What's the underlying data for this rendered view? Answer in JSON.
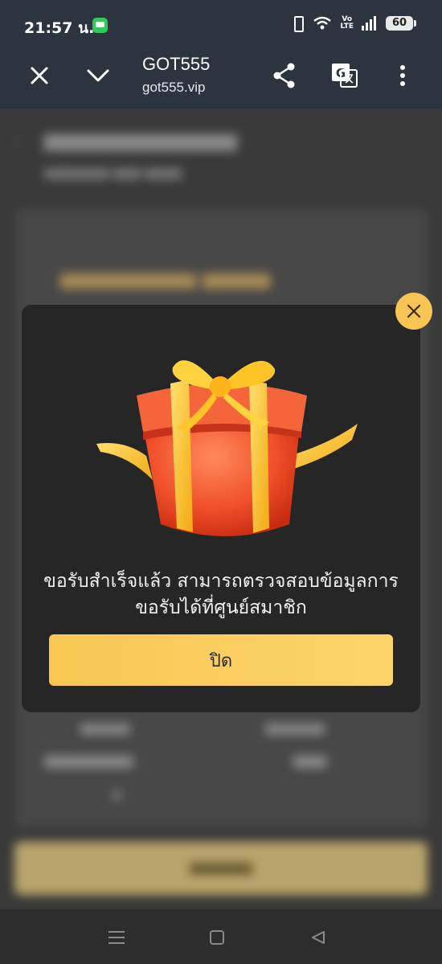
{
  "status_bar": {
    "time": "21:57 น.",
    "network_label": "Vo\nLTE",
    "battery": "60",
    "icons": [
      "message-icon",
      "vibrate-icon",
      "wifi-icon",
      "signal-icon",
      "battery-icon"
    ]
  },
  "browser": {
    "title": "GOT555",
    "url": "got555.vip",
    "icons": [
      "close-icon",
      "chevron-down-icon",
      "share-icon",
      "translate-icon",
      "more-vert-icon"
    ]
  },
  "modal": {
    "message": "ขอรับสำเร็จแล้ว สามารถตรวจสอบข้อมูลการขอรับได้ที่ศูนย์สมาชิก",
    "button_label": "ปิด",
    "close_icon": "close-icon",
    "accent_color": "#f7c653"
  },
  "navbar": {
    "icons": [
      "menu-icon",
      "home-square-icon",
      "back-triangle-icon"
    ]
  }
}
